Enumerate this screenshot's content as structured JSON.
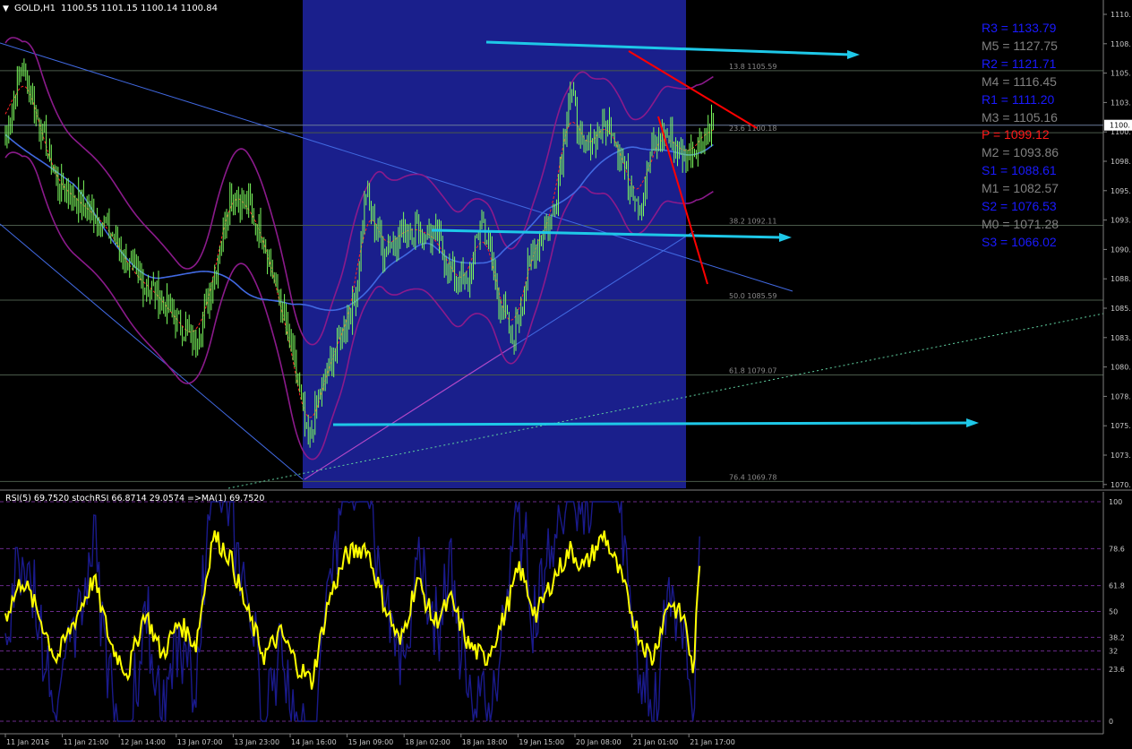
{
  "header": {
    "symbol_label": "GOLD,H1",
    "ohlc_label": "1100.55 1101.15 1100.14 1100.84"
  },
  "colors": {
    "background": "#000000",
    "highlight_band": "#1a1f8c",
    "candle": "#7cfc5e",
    "bollinger": "#8b1a8b",
    "ma_blue": "#4169e1",
    "ma_red": "#ff2222",
    "arrow_cyan": "#1ec8e8",
    "trend_red": "#ff0000",
    "rsi_yellow": "#ffff00",
    "rsi_navy": "#1a1a8c",
    "axis_text": "#c8c8c8"
  },
  "pivots": [
    {
      "label": "R3 = 1133.79",
      "color": "#1a1aff"
    },
    {
      "label": "M5 = 1127.75",
      "color": "#808080"
    },
    {
      "label": "R2 = 1121.71",
      "color": "#1a1aff"
    },
    {
      "label": "M4 = 1116.45",
      "color": "#808080"
    },
    {
      "label": "R1 = 1111.20",
      "color": "#1a1aff"
    },
    {
      "label": "M3 = 1105.16",
      "color": "#808080"
    },
    {
      "label": "P  = 1099.12",
      "color": "#ff1a1a"
    },
    {
      "label": "M2 = 1093.86",
      "color": "#808080"
    },
    {
      "label": "S1 = 1088.61",
      "color": "#1a1aff"
    },
    {
      "label": "M1 = 1082.57",
      "color": "#808080"
    },
    {
      "label": "S2 = 1076.53",
      "color": "#1a1aff"
    },
    {
      "label": "M0 = 1071.28",
      "color": "#808080"
    },
    {
      "label": "S3 = 1066.02",
      "color": "#1a1aff"
    }
  ],
  "fib_labels": [
    "13.8 1105.59",
    "23.6 1100.18",
    "38.2 1092.11",
    "50.0 1085.59",
    "61.8 1079.07",
    "76.4 1069.78"
  ],
  "current_price_label": "1100.",
  "rsi_header": "RSI(5) 69.7520  stochRSI 66.8714 29.0574  =>MA(1) 69.7520",
  "chart_data": {
    "type": "line",
    "title": "GOLD,H1",
    "x_ticks": [
      "11 Jan 2016",
      "11 Jan 21:00",
      "12 Jan 14:00",
      "13 Jan 07:00",
      "13 Jan 23:00",
      "14 Jan 16:00",
      "15 Jan 09:00",
      "18 Jan 02:00",
      "18 Jan 18:00",
      "19 Jan 15:00",
      "20 Jan 08:00",
      "21 Jan 01:00",
      "21 Jan 17:00"
    ],
    "price_ticks": [
      "1110.",
      "1108.",
      "1105.",
      "1103.",
      "1100.",
      "1098.",
      "1095.",
      "1093.",
      "1090.",
      "1088.",
      "1085.",
      "1083.",
      "1080.",
      "1078.",
      "1075.",
      "1073.",
      "1070."
    ],
    "price_ylim": [
      1069.5,
      1111.5
    ],
    "rsi_ticks": [
      "100",
      "78.6",
      "61.8",
      "50",
      "38.2",
      "32",
      "23.6",
      "0"
    ],
    "rsi_levels": [
      100,
      78.6,
      61.8,
      50,
      38.2,
      32,
      23.6,
      0
    ],
    "rsi_ylim": [
      0,
      100
    ],
    "fib_levels": [
      1105.59,
      1100.18,
      1092.11,
      1085.59,
      1079.07,
      1069.78
    ],
    "close_anchors": [
      [
        0,
        1100
      ],
      [
        10,
        1106
      ],
      [
        20,
        1101
      ],
      [
        30,
        1096
      ],
      [
        45,
        1094
      ],
      [
        60,
        1092
      ],
      [
        75,
        1088
      ],
      [
        90,
        1086
      ],
      [
        100,
        1084
      ],
      [
        112,
        1082
      ],
      [
        122,
        1087
      ],
      [
        132,
        1095
      ],
      [
        142,
        1094
      ],
      [
        152,
        1091
      ],
      [
        162,
        1085
      ],
      [
        170,
        1080
      ],
      [
        178,
        1073
      ],
      [
        186,
        1078
      ],
      [
        196,
        1082
      ],
      [
        206,
        1086
      ],
      [
        212,
        1095
      ],
      [
        222,
        1090
      ],
      [
        238,
        1092
      ],
      [
        254,
        1091
      ],
      [
        262,
        1088
      ],
      [
        272,
        1087
      ],
      [
        280,
        1093
      ],
      [
        290,
        1086
      ],
      [
        298,
        1082
      ],
      [
        310,
        1090
      ],
      [
        322,
        1093
      ],
      [
        332,
        1104
      ],
      [
        340,
        1098
      ],
      [
        346,
        1100
      ],
      [
        356,
        1101
      ],
      [
        366,
        1096
      ],
      [
        374,
        1094
      ],
      [
        380,
        1099
      ],
      [
        390,
        1100
      ],
      [
        400,
        1098
      ],
      [
        416,
        1101
      ]
    ],
    "rsi_anchors": [
      [
        0,
        48
      ],
      [
        10,
        65
      ],
      [
        20,
        48
      ],
      [
        30,
        28
      ],
      [
        40,
        45
      ],
      [
        52,
        65
      ],
      [
        62,
        35
      ],
      [
        72,
        22
      ],
      [
        82,
        50
      ],
      [
        92,
        30
      ],
      [
        102,
        45
      ],
      [
        112,
        35
      ],
      [
        122,
        85
      ],
      [
        132,
        75
      ],
      [
        142,
        50
      ],
      [
        152,
        30
      ],
      [
        162,
        40
      ],
      [
        172,
        25
      ],
      [
        180,
        18
      ],
      [
        190,
        55
      ],
      [
        200,
        75
      ],
      [
        212,
        80
      ],
      [
        222,
        55
      ],
      [
        232,
        35
      ],
      [
        242,
        65
      ],
      [
        252,
        45
      ],
      [
        262,
        55
      ],
      [
        272,
        35
      ],
      [
        282,
        28
      ],
      [
        292,
        45
      ],
      [
        302,
        70
      ],
      [
        312,
        48
      ],
      [
        322,
        65
      ],
      [
        332,
        78
      ],
      [
        340,
        70
      ],
      [
        352,
        85
      ],
      [
        362,
        65
      ],
      [
        372,
        40
      ],
      [
        380,
        28
      ],
      [
        390,
        55
      ],
      [
        400,
        45
      ],
      [
        404,
        20
      ],
      [
        408,
        70
      ]
    ],
    "series": [
      {
        "name": "RSI(5)",
        "values": [
          69.752
        ]
      },
      {
        "name": "stochRSI",
        "values": [
          66.8714,
          29.0574
        ]
      },
      {
        "name": "=>MA(1)",
        "values": [
          69.752
        ]
      }
    ],
    "pivot_points": [
      1133.79,
      1127.75,
      1121.71,
      1116.45,
      1111.2,
      1105.16,
      1099.12,
      1093.86,
      1088.61,
      1082.57,
      1076.53,
      1071.28,
      1066.02
    ]
  }
}
